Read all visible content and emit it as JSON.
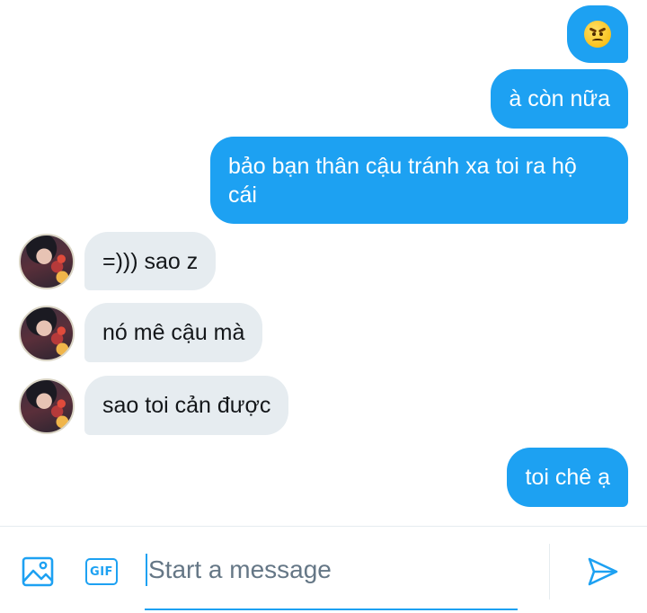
{
  "messages": [
    {
      "id": "m1",
      "direction": "outgoing",
      "emoji": "angry-face",
      "text": ""
    },
    {
      "id": "m2",
      "direction": "outgoing",
      "text": "à còn nữa"
    },
    {
      "id": "m3",
      "direction": "outgoing",
      "text": "bảo bạn thân cậu tránh xa toi ra hộ cái"
    },
    {
      "id": "m4",
      "direction": "incoming",
      "text": "=))) sao z"
    },
    {
      "id": "m5",
      "direction": "incoming",
      "text": "nó mê cậu mà"
    },
    {
      "id": "m6",
      "direction": "incoming",
      "text": "sao toi cản được"
    },
    {
      "id": "m7",
      "direction": "outgoing",
      "text": "toi chê ạ"
    }
  ],
  "composer": {
    "placeholder": "Start a message",
    "value": "",
    "gif_label": "GIF",
    "icons": {
      "media": "image-icon",
      "gif": "gif-icon",
      "send": "send-icon"
    }
  },
  "colors": {
    "accent": "#1da1f2",
    "incoming_bubble": "#e6ecf0",
    "incoming_text": "#14171a",
    "outgoing_text": "#ffffff",
    "placeholder": "#657786"
  }
}
